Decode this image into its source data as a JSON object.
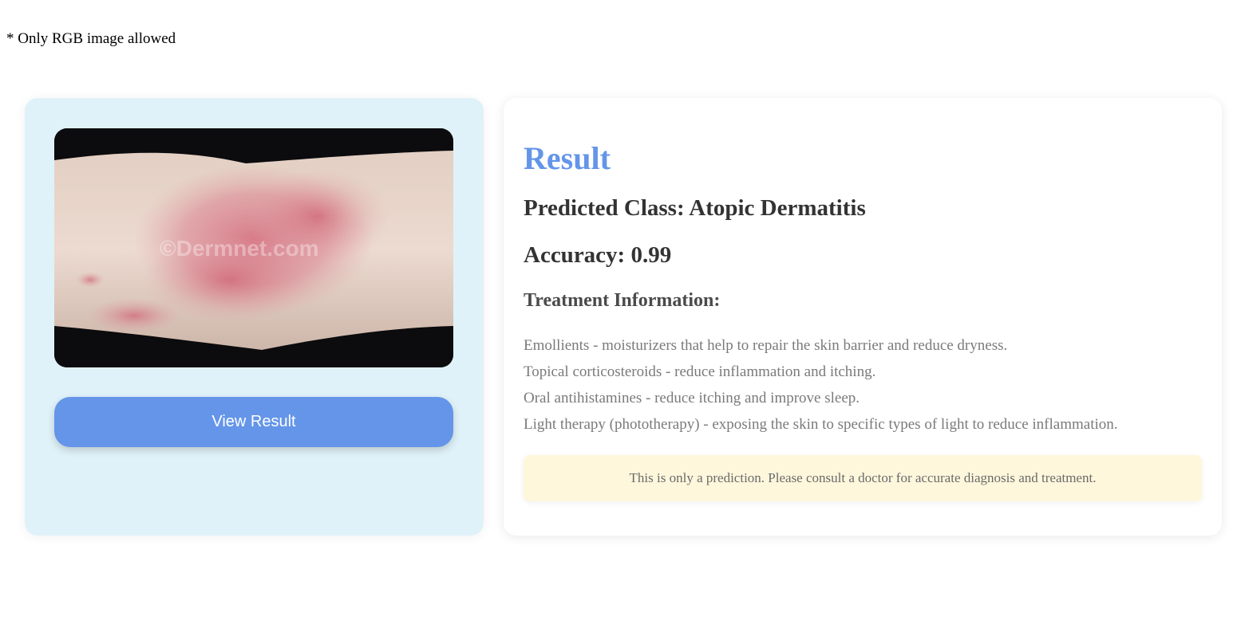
{
  "upload": {
    "note": "* Only RGB image allowed",
    "image_alt": "Uploaded skin image",
    "watermark": "©Dermnet.com",
    "button_label": "View Result"
  },
  "result": {
    "title": "Result",
    "predicted_class": "Predicted Class: Atopic Dermatitis",
    "accuracy": "Accuracy: 0.99",
    "treatment_heading": "Treatment Information:",
    "treatments": [
      "Emollients - moisturizers that help to repair the skin barrier and reduce dryness.",
      "Topical corticosteroids - reduce inflammation and itching.",
      "Oral antihistamines - reduce itching and improve sleep.",
      "Light therapy (phototherapy) - exposing the skin to specific types of light to reduce inflammation."
    ],
    "disclaimer": "This is only a prediction. Please consult a doctor for accurate diagnosis and treatment."
  },
  "colors": {
    "accent": "#6495e9",
    "left_panel_bg": "#e0f2f9",
    "disclaimer_bg": "#fff7dc"
  }
}
